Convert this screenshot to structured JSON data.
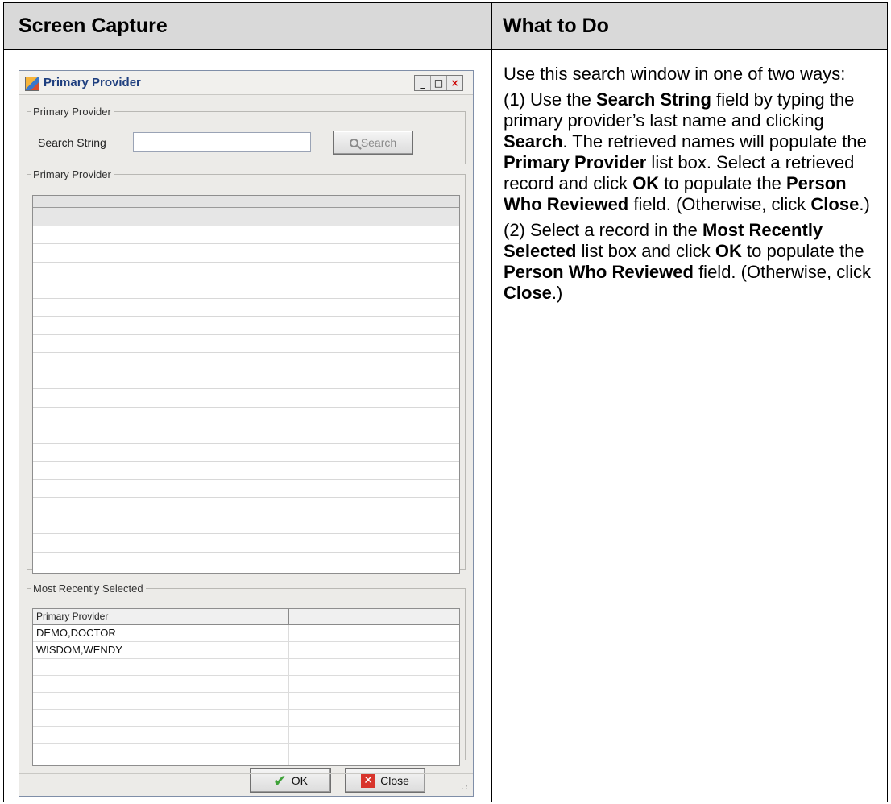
{
  "table": {
    "left_header": "Screen Capture",
    "right_header": "What to Do"
  },
  "instructions": {
    "p1": "Use this search window in one of two ways:",
    "p2": [
      {
        "t": "(1) Use the ",
        "b": false
      },
      {
        "t": "Search String",
        "b": true
      },
      {
        "t": " field by typing the primary provider’s last name and clicking ",
        "b": false
      },
      {
        "t": "Search",
        "b": true
      },
      {
        "t": ". The retrieved names will populate the ",
        "b": false
      },
      {
        "t": "Primary Provider",
        "b": true
      },
      {
        "t": " list box. Select a retrieved record and click ",
        "b": false
      },
      {
        "t": "OK",
        "b": true
      },
      {
        "t": " to populate the ",
        "b": false
      },
      {
        "t": "Person Who Reviewed",
        "b": true
      },
      {
        "t": " field. (Otherwise, click ",
        "b": false
      },
      {
        "t": "Close",
        "b": true
      },
      {
        "t": ".)",
        "b": false
      }
    ],
    "p3": [
      {
        "t": "(2) Select a record in the ",
        "b": false
      },
      {
        "t": "Most Recently Selected",
        "b": true
      },
      {
        "t": " list box and click ",
        "b": false
      },
      {
        "t": "OK",
        "b": true
      },
      {
        "t": " to populate the ",
        "b": false
      },
      {
        "t": "Person Who Reviewed",
        "b": true
      },
      {
        "t": " field. (Otherwise, click ",
        "b": false
      },
      {
        "t": "Close",
        "b": true
      },
      {
        "t": ".)",
        "b": false
      }
    ]
  },
  "dialog": {
    "title": "Primary Provider",
    "window_controls": [
      "_",
      "□",
      "×"
    ],
    "search_group": {
      "legend": "Primary Provider",
      "label": "Search String",
      "input_value": "",
      "search_button": "Search"
    },
    "results_group": {
      "legend": "Primary Provider",
      "row_count": 20
    },
    "recent_group": {
      "legend": "Most Recently Selected",
      "columns": [
        "Primary Provider",
        ""
      ],
      "rows": [
        "DEMO,DOCTOR",
        "WISDOM,WENDY",
        "",
        "",
        "",
        "",
        "",
        "",
        ""
      ]
    },
    "ok_button": "OK",
    "close_button": "Close",
    "icons": [
      "app-icon",
      "search-icon",
      "check-icon",
      "close-x-icon",
      "resize-grip-icon"
    ]
  }
}
